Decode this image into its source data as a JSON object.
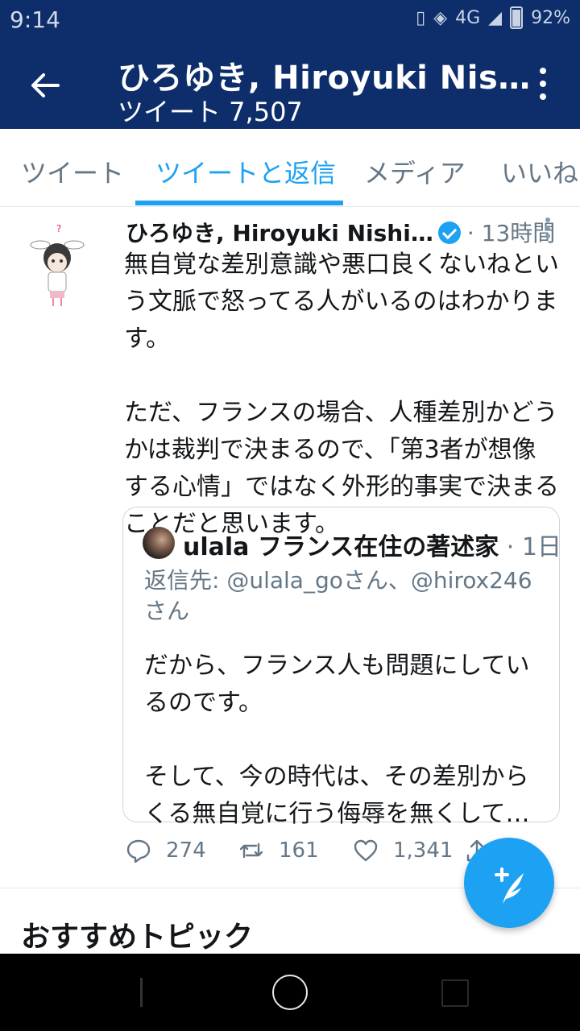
{
  "status_bar": {
    "time": "9:14",
    "network": "4G",
    "battery": "92%"
  },
  "header": {
    "title": "ひろゆき, Hiroyuki Nis…",
    "subtitle": "ツイート 7,507"
  },
  "tabs": [
    {
      "label": "ツイート",
      "active": false
    },
    {
      "label": "ツイートと返信",
      "active": true
    },
    {
      "label": "メディア",
      "active": false
    },
    {
      "label": "いいね",
      "active": false
    }
  ],
  "tweet": {
    "author": "ひろゆき, Hiroyuki Nishi…",
    "verified": true,
    "time": "· 13時間",
    "text": "無自覚な差別意識や悪口良くないねとい\nう文脈で怒ってる人がいるのはわかりま\nす。\n\nただ、フランスの場合、人種差別かどう\nかは裁判で決まるので、「第3者が想像\nする心情」ではなく外形的事実で決まる\nことだと思います。",
    "quote": {
      "author": "ulala フランス在住の著述家",
      "time": " · 1日",
      "reply_to": "返信先: @ulala_goさん、@hirox246\nさん",
      "text": "だから、フランス人も問題にしてい\nるのです。\n\nそして、今の時代は、その差別から\nくる無自覚に行う侮辱を無くして…"
    },
    "actions": {
      "replies": "274",
      "retweets": "161",
      "likes": "1,341"
    }
  },
  "section": {
    "title": "おすすめトピック"
  },
  "colors": {
    "header_bg": "#0d2e6b",
    "accent": "#1da1f2",
    "muted": "#657786"
  }
}
